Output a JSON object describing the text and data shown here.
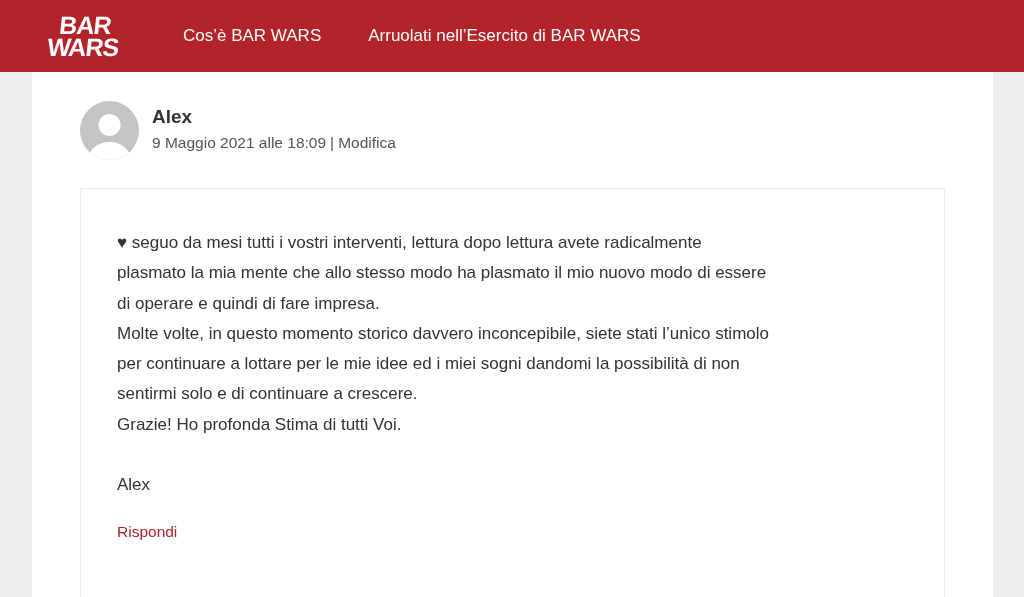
{
  "header": {
    "logo_lines": [
      "BAR",
      "WARS"
    ],
    "nav": [
      {
        "label": "Cos’è BAR WARS"
      },
      {
        "label": "Arruolati nell’Esercito di BAR WARS"
      }
    ]
  },
  "comment": {
    "author": "Alex",
    "date": "9 Maggio 2021 alle 18:09",
    "separator": "|",
    "edit_link": "Modifica",
    "lines": [
      "♥ seguo da mesi tutti i vostri interventi, lettura dopo lettura avete radicalmente",
      "plasmato la mia mente che allo stesso modo ha plasmato il mio nuovo modo di essere",
      "di operare e quindi di fare impresa.",
      "Molte volte, in questo momento storico davvero inconcepibile, siete stati l’unico stimolo",
      "per continuare a lottare per le mie idee ed i miei sogni dandomi la possibilità di non",
      "sentirmi solo e di continuare a crescere.",
      "Grazie! Ho profonda Stima di tutti Voi."
    ],
    "signature": "Alex",
    "reply_link": "Rispondi"
  }
}
